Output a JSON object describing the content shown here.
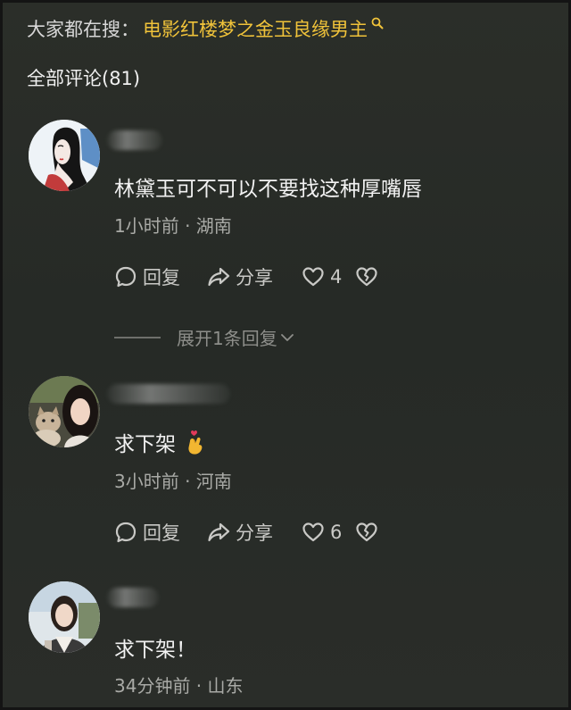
{
  "search": {
    "label": "大家都在搜：",
    "term": "电影红楼梦之金玉良缘男主"
  },
  "comments_header": {
    "label": "全部评论(81)"
  },
  "comments": [
    {
      "text": "林黛玉可不可以不要找这种厚嘴唇",
      "meta": "1小时前 · 湖南",
      "actions": {
        "reply": "回复",
        "share": "分享",
        "likes": "4"
      },
      "expand": "展开1条回复"
    },
    {
      "text": "求下架",
      "emoji": "pinching-hand-heart-emoji",
      "meta": "3小时前 · 河南",
      "actions": {
        "reply": "回复",
        "share": "分享",
        "likes": "6"
      }
    },
    {
      "text": "求下架！",
      "meta": "34分钟前 · 山东"
    }
  ],
  "colors": {
    "background": "#2a2d29",
    "highlight": "#f0c33a",
    "meta_text": "#a9aaa6"
  }
}
